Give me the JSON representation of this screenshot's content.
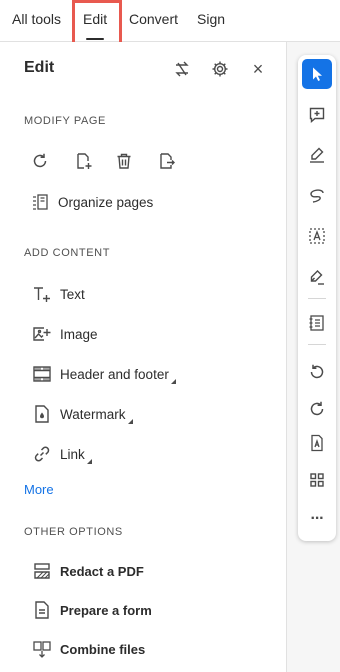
{
  "topbar": {
    "tabs": [
      {
        "label": "All tools"
      },
      {
        "label": "Edit"
      },
      {
        "label": "Convert"
      },
      {
        "label": "Sign"
      }
    ]
  },
  "panel": {
    "title": "Edit",
    "header_icons": [
      "swap-icon",
      "gear-icon",
      "close-icon"
    ],
    "close_glyph": "×",
    "modify_page": {
      "label": "MODIFY PAGE",
      "icons": [
        "rotate-icon",
        "insert-page-icon",
        "delete-icon",
        "extract-page-icon"
      ],
      "organize_label": "Organize pages"
    },
    "add_content": {
      "label": "ADD CONTENT",
      "items": [
        {
          "label": "Text",
          "icon": "add-text-icon"
        },
        {
          "label": "Image",
          "icon": "add-image-icon"
        },
        {
          "label": "Header and footer",
          "icon": "header-footer-icon"
        },
        {
          "label": "Watermark",
          "icon": "watermark-icon"
        },
        {
          "label": "Link",
          "icon": "link-icon"
        }
      ],
      "more_label": "More"
    },
    "other_options": {
      "label": "OTHER OPTIONS",
      "items": [
        {
          "label": "Redact a PDF",
          "icon": "redact-icon"
        },
        {
          "label": "Prepare a form",
          "icon": "form-icon"
        },
        {
          "label": "Combine files",
          "icon": "combine-icon"
        }
      ]
    }
  },
  "toolbar": {
    "items": [
      "cursor-icon",
      "add-comment-icon",
      "highlight-icon",
      "draw-icon",
      "select-text-icon",
      "sign-icon",
      "scan-icon",
      "undo-icon",
      "redo-icon",
      "pdf-file-icon",
      "grid-icon",
      "more-icon"
    ],
    "more_glyph": "···"
  },
  "colors": {
    "accent": "#1473e6",
    "highlight_box": "#e8594f"
  }
}
